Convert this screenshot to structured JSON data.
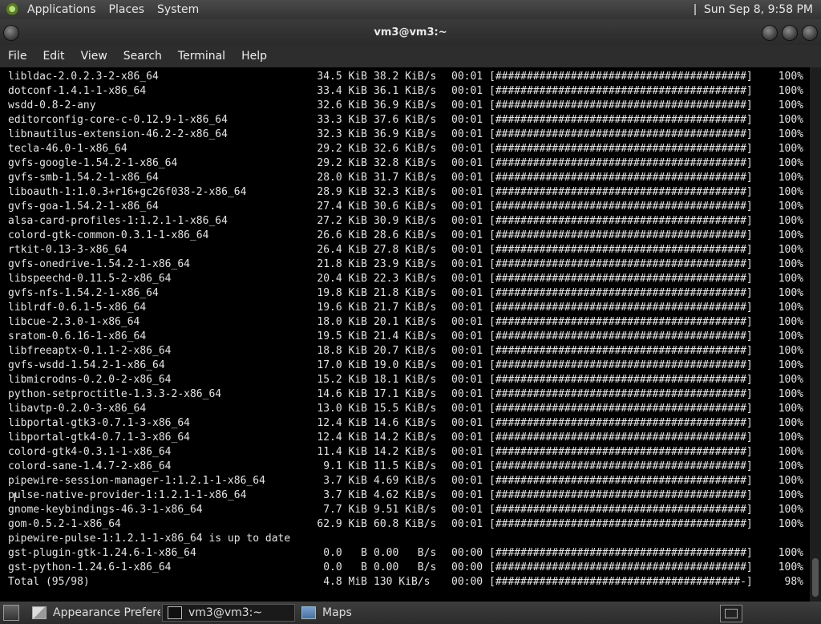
{
  "top_panel": {
    "menus": [
      "Applications",
      "Places",
      "System"
    ],
    "clock": "Sun Sep  8,  9:58 PM"
  },
  "window": {
    "title": "vm3@vm3:~"
  },
  "menubar": [
    "File",
    "Edit",
    "View",
    "Search",
    "Terminal",
    "Help"
  ],
  "terminal": {
    "progress_bar_full": "[########################################]",
    "progress_bar_partial": "[#######################################-]",
    "rows": [
      {
        "name": "libldac-2.0.2.3-2-x86_64",
        "size": "34.5 KiB",
        "speed": "38.2 KiB/s",
        "time": "00:01",
        "complete": true,
        "pct": "100%"
      },
      {
        "name": "dotconf-1.4.1-1-x86_64",
        "size": "33.4 KiB",
        "speed": "36.1 KiB/s",
        "time": "00:01",
        "complete": true,
        "pct": "100%"
      },
      {
        "name": "wsdd-0.8-2-any",
        "size": "32.6 KiB",
        "speed": "36.9 KiB/s",
        "time": "00:01",
        "complete": true,
        "pct": "100%"
      },
      {
        "name": "editorconfig-core-c-0.12.9-1-x86_64",
        "size": "33.3 KiB",
        "speed": "37.6 KiB/s",
        "time": "00:01",
        "complete": true,
        "pct": "100%"
      },
      {
        "name": "libnautilus-extension-46.2-2-x86_64",
        "size": "32.3 KiB",
        "speed": "36.9 KiB/s",
        "time": "00:01",
        "complete": true,
        "pct": "100%"
      },
      {
        "name": "tecla-46.0-1-x86_64",
        "size": "29.2 KiB",
        "speed": "32.6 KiB/s",
        "time": "00:01",
        "complete": true,
        "pct": "100%"
      },
      {
        "name": "gvfs-google-1.54.2-1-x86_64",
        "size": "29.2 KiB",
        "speed": "32.8 KiB/s",
        "time": "00:01",
        "complete": true,
        "pct": "100%"
      },
      {
        "name": "gvfs-smb-1.54.2-1-x86_64",
        "size": "28.0 KiB",
        "speed": "31.7 KiB/s",
        "time": "00:01",
        "complete": true,
        "pct": "100%"
      },
      {
        "name": "liboauth-1:1.0.3+r16+gc26f038-2-x86_64",
        "size": "28.9 KiB",
        "speed": "32.3 KiB/s",
        "time": "00:01",
        "complete": true,
        "pct": "100%"
      },
      {
        "name": "gvfs-goa-1.54.2-1-x86_64",
        "size": "27.4 KiB",
        "speed": "30.6 KiB/s",
        "time": "00:01",
        "complete": true,
        "pct": "100%"
      },
      {
        "name": "alsa-card-profiles-1:1.2.1-1-x86_64",
        "size": "27.2 KiB",
        "speed": "30.9 KiB/s",
        "time": "00:01",
        "complete": true,
        "pct": "100%"
      },
      {
        "name": "colord-gtk-common-0.3.1-1-x86_64",
        "size": "26.6 KiB",
        "speed": "28.6 KiB/s",
        "time": "00:01",
        "complete": true,
        "pct": "100%"
      },
      {
        "name": "rtkit-0.13-3-x86_64",
        "size": "26.4 KiB",
        "speed": "27.8 KiB/s",
        "time": "00:01",
        "complete": true,
        "pct": "100%"
      },
      {
        "name": "gvfs-onedrive-1.54.2-1-x86_64",
        "size": "21.8 KiB",
        "speed": "23.9 KiB/s",
        "time": "00:01",
        "complete": true,
        "pct": "100%"
      },
      {
        "name": "libspeechd-0.11.5-2-x86_64",
        "size": "20.4 KiB",
        "speed": "22.3 KiB/s",
        "time": "00:01",
        "complete": true,
        "pct": "100%"
      },
      {
        "name": "gvfs-nfs-1.54.2-1-x86_64",
        "size": "19.8 KiB",
        "speed": "21.8 KiB/s",
        "time": "00:01",
        "complete": true,
        "pct": "100%"
      },
      {
        "name": "liblrdf-0.6.1-5-x86_64",
        "size": "19.6 KiB",
        "speed": "21.7 KiB/s",
        "time": "00:01",
        "complete": true,
        "pct": "100%"
      },
      {
        "name": "libcue-2.3.0-1-x86_64",
        "size": "18.0 KiB",
        "speed": "20.1 KiB/s",
        "time": "00:01",
        "complete": true,
        "pct": "100%"
      },
      {
        "name": "sratom-0.6.16-1-x86_64",
        "size": "19.5 KiB",
        "speed": "21.4 KiB/s",
        "time": "00:01",
        "complete": true,
        "pct": "100%"
      },
      {
        "name": "libfreeaptx-0.1.1-2-x86_64",
        "size": "18.8 KiB",
        "speed": "20.7 KiB/s",
        "time": "00:01",
        "complete": true,
        "pct": "100%"
      },
      {
        "name": "gvfs-wsdd-1.54.2-1-x86_64",
        "size": "17.0 KiB",
        "speed": "19.0 KiB/s",
        "time": "00:01",
        "complete": true,
        "pct": "100%"
      },
      {
        "name": "libmicrodns-0.2.0-2-x86_64",
        "size": "15.2 KiB",
        "speed": "18.1 KiB/s",
        "time": "00:01",
        "complete": true,
        "pct": "100%"
      },
      {
        "name": "python-setproctitle-1.3.3-2-x86_64",
        "size": "14.6 KiB",
        "speed": "17.1 KiB/s",
        "time": "00:01",
        "complete": true,
        "pct": "100%"
      },
      {
        "name": "libavtp-0.2.0-3-x86_64",
        "size": "13.0 KiB",
        "speed": "15.5 KiB/s",
        "time": "00:01",
        "complete": true,
        "pct": "100%"
      },
      {
        "name": "libportal-gtk3-0.7.1-3-x86_64",
        "size": "12.4 KiB",
        "speed": "14.6 KiB/s",
        "time": "00:01",
        "complete": true,
        "pct": "100%"
      },
      {
        "name": "libportal-gtk4-0.7.1-3-x86_64",
        "size": "12.4 KiB",
        "speed": "14.2 KiB/s",
        "time": "00:01",
        "complete": true,
        "pct": "100%"
      },
      {
        "name": "colord-gtk4-0.3.1-1-x86_64",
        "size": "11.4 KiB",
        "speed": "14.2 KiB/s",
        "time": "00:01",
        "complete": true,
        "pct": "100%"
      },
      {
        "name": "colord-sane-1.4.7-2-x86_64",
        "size": "9.1 KiB",
        "speed": "11.5 KiB/s",
        "time": "00:01",
        "complete": true,
        "pct": "100%"
      },
      {
        "name": "pipewire-session-manager-1:1.2.1-1-x86_64",
        "size": "3.7 KiB",
        "speed": "4.69 KiB/s",
        "time": "00:01",
        "complete": true,
        "pct": "100%"
      },
      {
        "name": "pulse-native-provider-1:1.2.1-1-x86_64",
        "size": "3.7 KiB",
        "speed": "4.62 KiB/s",
        "time": "00:01",
        "complete": true,
        "pct": "100%"
      },
      {
        "name": "gnome-keybindings-46.3-1-x86_64",
        "size": "7.7 KiB",
        "speed": "9.51 KiB/s",
        "time": "00:01",
        "complete": true,
        "pct": "100%"
      },
      {
        "name": "gom-0.5.2-1-x86_64",
        "size": "62.9 KiB",
        "speed": "60.8 KiB/s",
        "time": "00:01",
        "complete": true,
        "pct": "100%"
      },
      {
        "text": "pipewire-pulse-1:1.2.1-1-x86_64 is up to date"
      },
      {
        "name": "gst-plugin-gtk-1.24.6-1-x86_64",
        "size": "0.0   B",
        "speed": "0.00   B/s",
        "time": "00:00",
        "complete": true,
        "pct": "100%"
      },
      {
        "name": "gst-python-1.24.6-1-x86_64",
        "size": "0.0   B",
        "speed": "0.00   B/s",
        "time": "00:00",
        "complete": true,
        "pct": "100%"
      },
      {
        "name": "Total (95/98)",
        "size": "4.8 MiB",
        "speed": "130 KiB/s",
        "time": "00:00",
        "complete": false,
        "pct": "98%"
      }
    ]
  },
  "taskbar": {
    "tasks": [
      {
        "label": "Appearance Prefere...",
        "icon": "appearance-icon"
      },
      {
        "label": "vm3@vm3:~",
        "icon": "terminal-icon"
      },
      {
        "label": "Maps",
        "icon": "maps-icon"
      }
    ]
  }
}
